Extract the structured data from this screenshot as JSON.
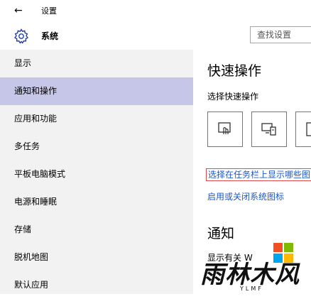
{
  "window": {
    "title": "设置",
    "back_icon": "back-arrow-icon"
  },
  "header": {
    "title": "系统",
    "icon": "gear-icon",
    "search_placeholder": "查找设置"
  },
  "sidebar": {
    "items": [
      {
        "label": "显示"
      },
      {
        "label": "通知和操作",
        "active": true
      },
      {
        "label": "应用和功能"
      },
      {
        "label": "多任务"
      },
      {
        "label": "平板电脑模式"
      },
      {
        "label": "电源和睡眠"
      },
      {
        "label": "存储"
      },
      {
        "label": "脱机地图"
      },
      {
        "label": "默认应用"
      }
    ]
  },
  "content": {
    "quick_actions": {
      "heading": "快速操作",
      "subheading": "选择快速操作",
      "tiles": [
        "tablet-mode-icon",
        "connect-icon",
        "note-icon"
      ]
    },
    "links": {
      "taskbar_icons": "选择在任务栏上显示哪些图",
      "system_icons": "启用或关闭系统图标"
    },
    "notifications": {
      "heading": "通知",
      "show_about": "显示有关 W"
    }
  },
  "watermark": {
    "brand_text": "雨林木风",
    "sub_text": "YLMF"
  },
  "colors": {
    "sidebar_bg": "#f2f2f2",
    "active_item_bg": "#c6c6e9",
    "link": "#1d59c7",
    "highlight_border": "#e04a4a"
  }
}
